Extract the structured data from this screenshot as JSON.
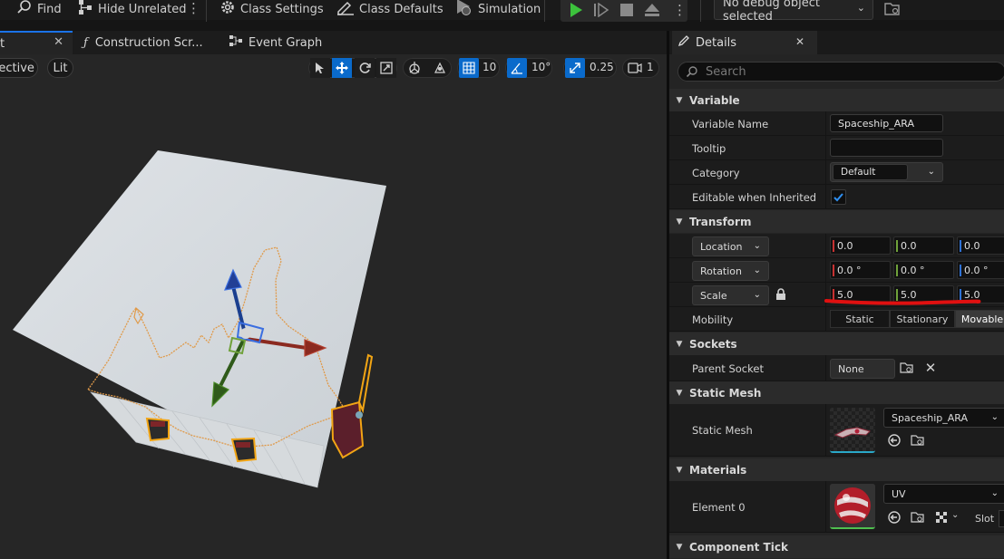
{
  "toolbar": {
    "find": "Find",
    "hide_unrelated": "Hide Unrelated",
    "class_settings": "Class Settings",
    "class_defaults": "Class Defaults",
    "simulation": "Simulation",
    "debug_object": "No debug object selected"
  },
  "tabs": {
    "viewport_tab_fragment": "t",
    "construction_script": "Construction Scr...",
    "event_graph": "Event Graph"
  },
  "viewport": {
    "view_mode": "pective",
    "lighting": "Lit",
    "grid_snap": "10",
    "rotation_snap": "10°",
    "scale_snap": "0.25",
    "camera_speed": "1"
  },
  "details": {
    "title": "Details",
    "search_placeholder": "Search",
    "categories": {
      "variable": "Variable",
      "transform": "Transform",
      "sockets": "Sockets",
      "static_mesh": "Static Mesh",
      "materials": "Materials",
      "component_tick": "Component Tick"
    },
    "variable": {
      "name_label": "Variable Name",
      "name_value": "Spaceship_ARA",
      "tooltip_label": "Tooltip",
      "tooltip_value": "",
      "category_label": "Category",
      "category_value": "Default",
      "editable_label": "Editable when Inherited",
      "editable_checked": true
    },
    "transform": {
      "location_label": "Location",
      "location": [
        "0.0",
        "0.0",
        "0.0"
      ],
      "rotation_label": "Rotation",
      "rotation": [
        "0.0 °",
        "0.0 °",
        "0.0 °"
      ],
      "scale_label": "Scale",
      "scale": [
        "5.0",
        "5.0",
        "5.0"
      ],
      "mobility_label": "Mobility",
      "mobility_options": [
        "Static",
        "Stationary",
        "Movable"
      ],
      "mobility_selected": "Movable"
    },
    "sockets": {
      "parent_socket_label": "Parent Socket",
      "parent_socket_value": "None"
    },
    "static_mesh": {
      "label": "Static Mesh",
      "value": "Spaceship_ARA"
    },
    "materials": {
      "element0_label": "Element 0",
      "element0_value": "UV",
      "slot_label": "Slot"
    }
  },
  "colors": {
    "accent_blue": "#0a6acb",
    "play_green": "#3cc23c",
    "annotation_red": "#e01010",
    "selection_orange": "#f2a514"
  }
}
